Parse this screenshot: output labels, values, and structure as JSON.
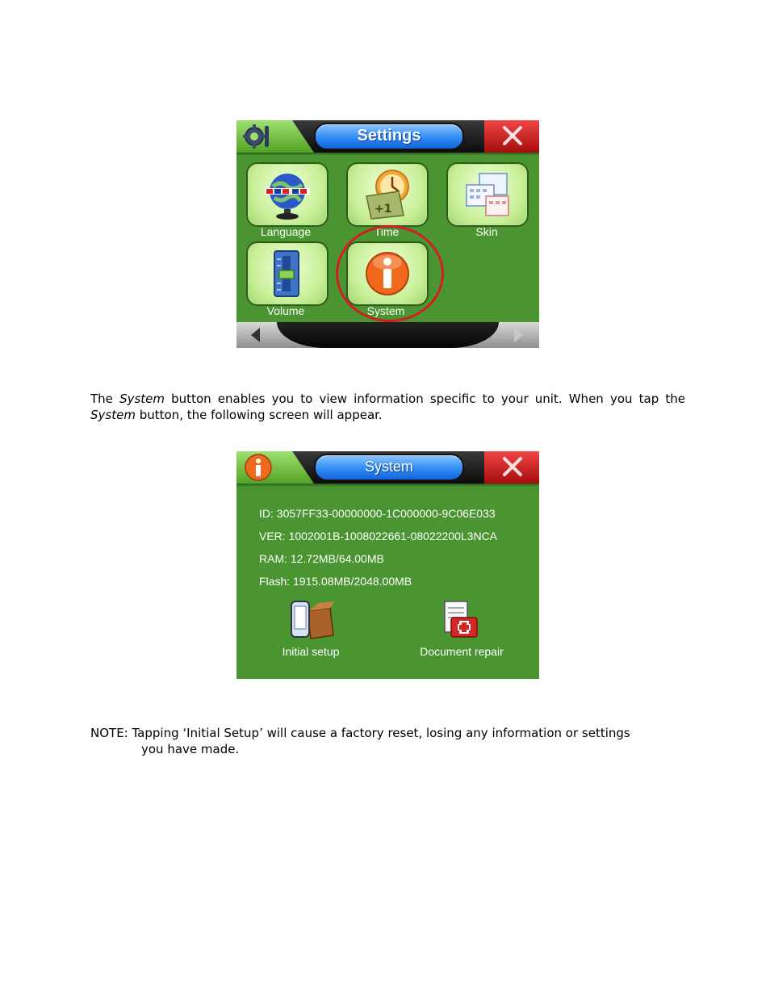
{
  "settings_screen": {
    "title": "Settings",
    "tiles": [
      {
        "label": "Language",
        "icon": "globe-flags-icon"
      },
      {
        "label": "Time",
        "icon": "clock-calendar-icon"
      },
      {
        "label": "Skin",
        "icon": "skin-windows-icon"
      },
      {
        "label": "Volume",
        "icon": "speaker-icon"
      },
      {
        "label": "System",
        "icon": "info-icon"
      }
    ],
    "highlight_color": "#d41d22"
  },
  "paragraph": {
    "w1": "The",
    "em1": "System",
    "t1": "button enables you to view information specific to your unit.  When you tap the",
    "em2": "System",
    "t2": "button, the following screen will appear."
  },
  "system_screen": {
    "title": "System",
    "info": [
      "ID:  3057FF33-00000000-1C000000-9C06E033",
      "VER:  1002001B-1008022661-08022200L3NCA",
      "RAM:  12.72MB/64.00MB",
      "Flash:  1915.08MB/2048.00MB"
    ],
    "buttons": [
      {
        "label": "Initial setup",
        "icon": "device-box-icon"
      },
      {
        "label": "Document repair",
        "icon": "document-first-aid-icon"
      }
    ]
  },
  "note": {
    "line1": "NOTE:  Tapping ‘Initial Setup’ will cause a factory reset, losing any information or settings",
    "line2": "you have made."
  },
  "colors": {
    "screen_green": "#4a9431",
    "title_blue": "#2f8cf5",
    "close_red": "#c41e1e"
  }
}
